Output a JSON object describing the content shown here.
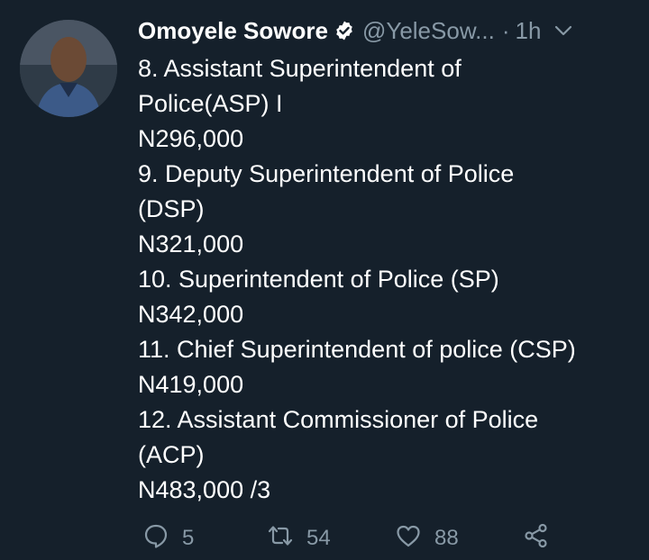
{
  "tweet": {
    "author_name": "Omoyele Sowore",
    "handle": "@YeleSow...",
    "separator": "·",
    "time": "1h",
    "lines": [
      "8. Assistant Superintendent of",
      "Police(ASP) I",
      "N296,000",
      "9. Deputy Superintendent of Police",
      "(DSP)",
      "N321,000",
      "10. Superintendent of Police (SP)",
      "N342,000",
      "11. Chief Superintendent of police (CSP)",
      "N419,000",
      "12. Assistant Commissioner of Police",
      "(ACP)",
      "N483,000 /3"
    ],
    "counts": {
      "replies": "5",
      "retweets": "54",
      "likes": "88"
    }
  },
  "icons": {
    "verified": "verified-badge-icon",
    "menu": "chevron-down-icon",
    "reply": "reply-icon",
    "retweet": "retweet-icon",
    "like": "heart-icon",
    "share": "share-icon"
  },
  "colors": {
    "background": "#15202b",
    "text": "#ffffff",
    "muted": "#8899a6"
  }
}
